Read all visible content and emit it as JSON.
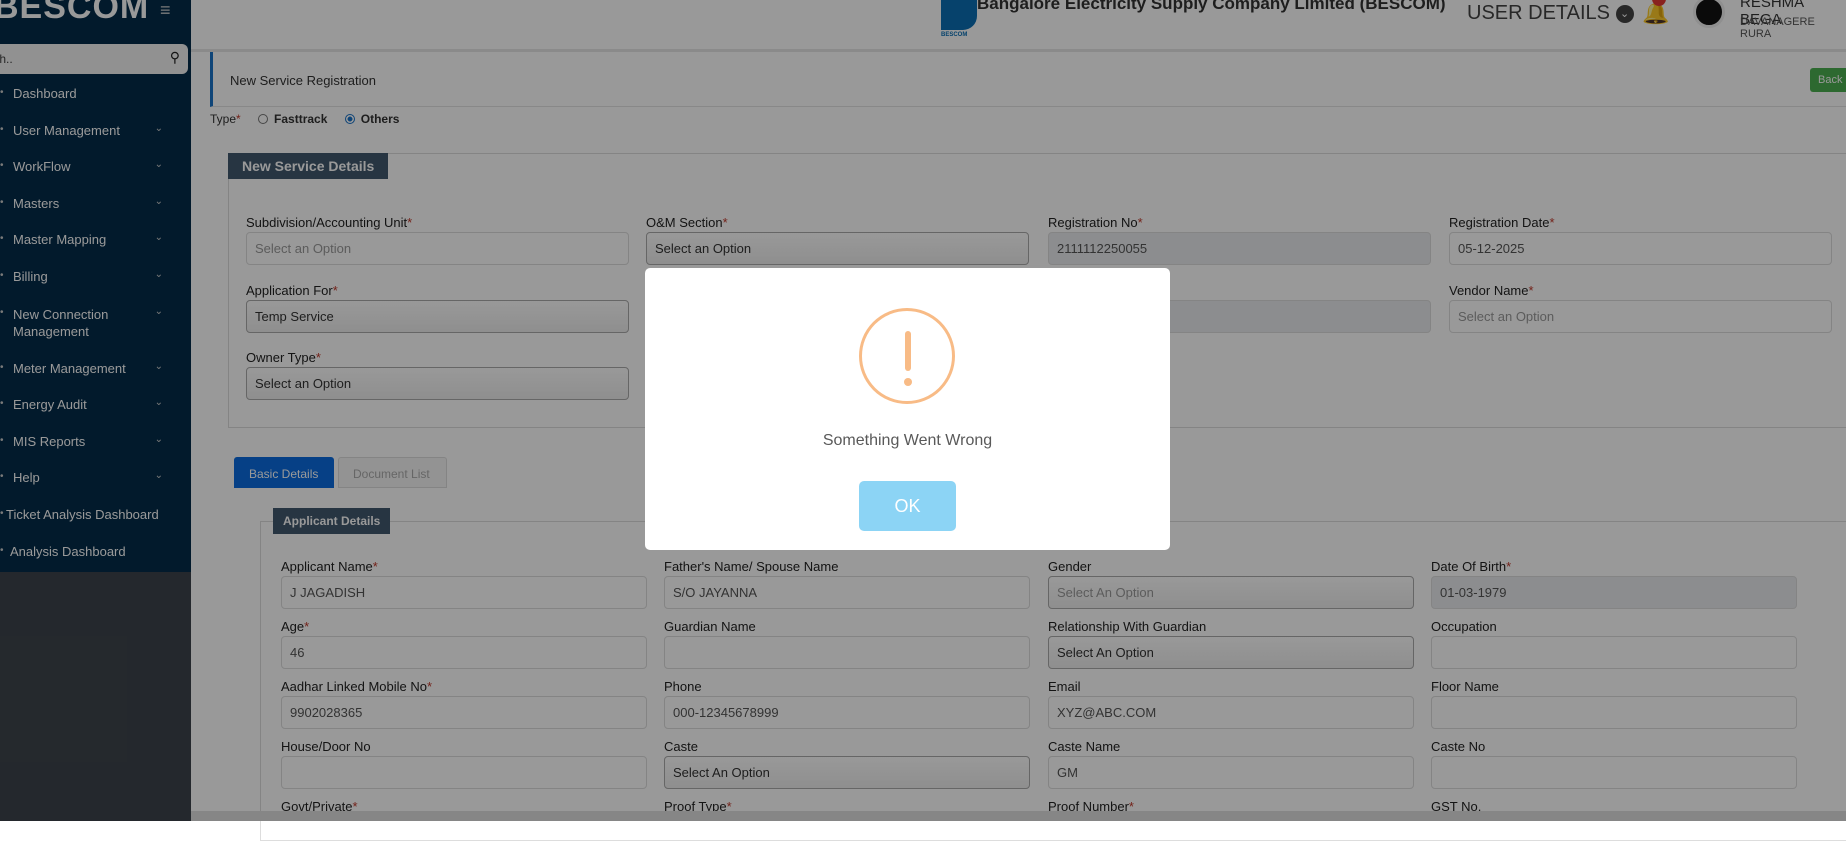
{
  "sidebar": {
    "brand": "BESCOM",
    "search_placeholder": "Search..",
    "search_value": "h..",
    "items": [
      {
        "label": "Dashboard"
      },
      {
        "label": "User Management"
      },
      {
        "label": "WorkFlow"
      },
      {
        "label": "Masters"
      },
      {
        "label": "Master Mapping"
      },
      {
        "label": "Billing"
      },
      {
        "label": "New Connection Management"
      },
      {
        "label": "Meter Management"
      },
      {
        "label": "Energy Audit"
      },
      {
        "label": "MIS Reports"
      },
      {
        "label": "Help"
      },
      {
        "label": "Ticket Analysis Dashboard"
      },
      {
        "label": "Analysis Dashboard"
      }
    ]
  },
  "header": {
    "logo_text": "BESCOM",
    "title": "Bangalore Electricity Supply Company Limited (BESCOM)",
    "user_details": "USER DETAILS",
    "user_name": "RESHMA BEGA",
    "user_location": "DAVANAGERE RURA"
  },
  "page": {
    "title": "New Service Registration",
    "back": "Back",
    "type_label": "Type",
    "type_options": [
      "Fasttrack",
      "Others"
    ],
    "type_selected": "Others"
  },
  "service_details": {
    "heading": "New Service Details",
    "fields": [
      {
        "label": "Subdivision/Accounting Unit",
        "value": "Select an Option",
        "required": true
      },
      {
        "label": "O&M Section",
        "value": "Select an Option",
        "required": true
      },
      {
        "label": "Registration No",
        "value": "2111112250055",
        "required": true
      },
      {
        "label": "Registration Date",
        "value": "05-12-2025",
        "required": true
      },
      {
        "label": "Application For",
        "value": "Temp Service",
        "required": true
      },
      {
        "label": "",
        "value": ""
      },
      {
        "label": "",
        "value": ""
      },
      {
        "label": "Vendor Name",
        "value": "Select an Option",
        "required": true
      },
      {
        "label": "Owner Type",
        "value": "Select an Option",
        "required": true
      }
    ]
  },
  "tabs": [
    {
      "label": "Basic Details"
    },
    {
      "label": "Document List"
    }
  ],
  "applicant": {
    "heading": "Applicant Details",
    "fields": [
      {
        "label": "Applicant Name",
        "value": "J JAGADISH",
        "required": true
      },
      {
        "label": "Father's Name/ Spouse Name",
        "value": "S/O JAYANNA"
      },
      {
        "label": "Gender",
        "value": "Select An Option"
      },
      {
        "label": "Date Of Birth",
        "value": "01-03-1979",
        "required": true
      },
      {
        "label": "Age",
        "value": "46",
        "required": true
      },
      {
        "label": "Guardian Name",
        "value": ""
      },
      {
        "label": "Relationship With Guardian",
        "value": "Select An Option"
      },
      {
        "label": "Occupation",
        "value": ""
      },
      {
        "label": "Aadhar Linked Mobile No",
        "value": "9902028365",
        "required": true
      },
      {
        "label": "Phone",
        "value": "000-12345678999"
      },
      {
        "label": "Email",
        "value": "XYZ@ABC.COM"
      },
      {
        "label": "Floor Name",
        "value": ""
      },
      {
        "label": "House/Door No",
        "value": ""
      },
      {
        "label": "Caste",
        "value": "Select An Option"
      },
      {
        "label": "Caste Name",
        "value": "GM"
      },
      {
        "label": "Caste No",
        "value": ""
      },
      {
        "label": "Govt/Private",
        "required": true
      },
      {
        "label": "Proof Type",
        "required": true
      },
      {
        "label": "Proof Number",
        "required": true
      },
      {
        "label": "GST No."
      }
    ]
  },
  "modal": {
    "icon": "warning-icon",
    "message": "Something Went Wrong",
    "ok": "OK",
    "icon_color": "#f8bb86",
    "button_color": "#8cd4f5"
  }
}
